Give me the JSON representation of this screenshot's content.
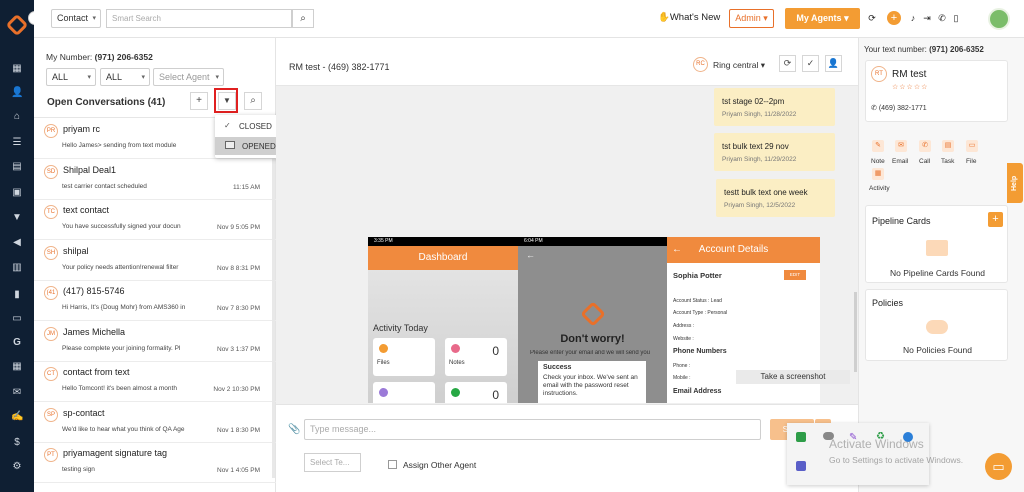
{
  "topbar": {
    "contact_select": "Contact",
    "search_placeholder": "Smart Search",
    "whats_new": "What's New",
    "admin": "Admin",
    "my_agents": "My Agents"
  },
  "left": {
    "my_number_label": "My Number:",
    "my_number": "(971) 206-6352",
    "filter1": "ALL",
    "filter2": "ALL",
    "agent_placeholder": "Select Agent",
    "title": "Open Conversations (41)",
    "conversations": [
      {
        "initials": "PR",
        "name": "priyam rc",
        "preview": "Hello James> sending from text module",
        "time": ""
      },
      {
        "initials": "SD",
        "name": "Shilpal Deal1",
        "preview": "test carrier contact scheduled",
        "time": "11:15 AM"
      },
      {
        "initials": "TC",
        "name": "text contact",
        "preview": "You have successfully signed your docun",
        "time": "Nov 9 5:05 PM"
      },
      {
        "initials": "SH",
        "name": "shilpal",
        "preview": "Your policy needs attention!renewal filter",
        "time": "Nov 8 8:31 PM"
      },
      {
        "initials": "(41",
        "name": "(417) 815-5746",
        "preview": "Hi Harris, It's {Doug Mohr} from AMS360 in",
        "time": "Nov 7 8:30 PM"
      },
      {
        "initials": "JM",
        "name": "James Michella",
        "preview": "Please complete your joining formality. Pl",
        "time": "Nov 3 1:37 PM"
      },
      {
        "initials": "CT",
        "name": "contact from text",
        "preview": "Hello Tomcont! it's been almost a month",
        "time": "Nov 2 10:30 PM"
      },
      {
        "initials": "SP",
        "name": "sp-contact",
        "preview": "We'd like to hear what you think of QA Age",
        "time": "Nov 1 8:30 PM"
      },
      {
        "initials": "PT",
        "name": "priyamagent signature tag",
        "preview": "testing sign",
        "time": "Nov 1 4:05 PM"
      }
    ]
  },
  "dropdown": {
    "closed": "CLOSED",
    "opened": "OPENED"
  },
  "chat": {
    "title": "RM test - (469) 382-1771",
    "carrier_initials": "RC",
    "carrier": "Ring central",
    "messages": [
      {
        "text": "tst stage 02--2pm",
        "meta": "Priyam Singh, 11/28/2022"
      },
      {
        "text": "tst bulk text 29 nov",
        "meta": "Priyam Singh, 11/29/2022"
      },
      {
        "text": "testt bulk text one week",
        "meta": "Priyam Singh, 12/5/2022"
      }
    ],
    "composer_placeholder": "Type message...",
    "template_placeholder": "Select Te...",
    "assign_label": "Assign Other Agent",
    "send": "Send"
  },
  "screenshot": {
    "dash_title": "Dashboard",
    "activity": "Activity Today",
    "files": "Files",
    "notes": "Notes",
    "zero": "0",
    "time1": "3:35 PM",
    "time2": "6:04 PM",
    "dont_worry": "Don't worry!",
    "enter_email": "Please enter your email and we will send you",
    "success": "Success",
    "success_msg": "Check your inbox. We've sent an email with the password reset instructions.",
    "account_details": "Account Details",
    "person": "Sophia Potter",
    "edit": "EDIT",
    "account_status": "Account Status : Lead",
    "account_type": "Account Type : Personal",
    "address": "Address :",
    "website": "Website :",
    "phone_numbers": "Phone Numbers",
    "phone": "Phone :",
    "mobile": "Mobile :",
    "email_address": "Email Address",
    "take_screenshot": "Take a screenshot"
  },
  "right": {
    "your_number_label": "Your text number:",
    "your_number": "(971) 206-6352",
    "contact_initials": "RT",
    "contact_name": "RM test",
    "contact_phone": "(469) 382-1771",
    "actions": [
      "Note",
      "Email",
      "Call",
      "Task",
      "File",
      "Activity"
    ],
    "pipeline_title": "Pipeline Cards",
    "no_pipeline": "No Pipeline Cards Found",
    "policies_title": "Policies",
    "no_policies": "No Policies Found",
    "help": "Help"
  },
  "watermark": {
    "line1": "Activate Windows",
    "line2": "Go to Settings to activate Windows."
  },
  "colors": {
    "accent": "#e8702a",
    "rail": "#0f1f33",
    "bubble": "#fbeec4"
  }
}
